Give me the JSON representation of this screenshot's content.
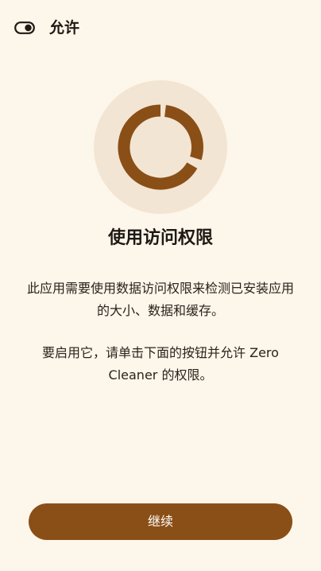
{
  "topbar": {
    "icon": "toggle-icon",
    "title": "允许"
  },
  "hero": {
    "icon": "disk-usage-ring-icon",
    "ring_color": "#8a4f17",
    "circle_color": "#f3e5d3"
  },
  "content": {
    "heading": "使用访问权限",
    "paragraph_1": "此应用需要使用数据访问权限来检测已安装应用的大小、数据和缓存。",
    "paragraph_2": "要启用它，请单击下面的按钮并允许 Zero Cleaner 的权限。"
  },
  "actions": {
    "continue_label": "继续",
    "button_color": "#8a4f17"
  }
}
